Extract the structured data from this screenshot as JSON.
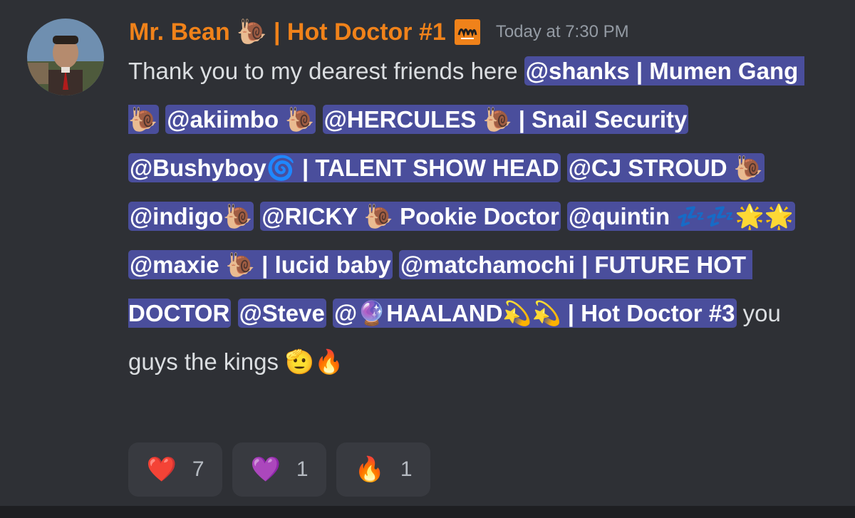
{
  "message": {
    "author": "Mr. Bean 🐌 | Hot Doctor #1",
    "timestamp": "Today at 7:30 PM",
    "content": [
      {
        "type": "text",
        "text": "Thank you to my dearest friends here "
      },
      {
        "type": "mention",
        "text": "@shanks | Mumen Gang 🐌"
      },
      {
        "type": "text",
        "text": " "
      },
      {
        "type": "mention",
        "text": "@akiimbo 🐌"
      },
      {
        "type": "text",
        "text": " "
      },
      {
        "type": "mention",
        "text": "@HERCULES 🐌 | Snail Security"
      },
      {
        "type": "text",
        "text": " "
      },
      {
        "type": "mention",
        "text": "@Bushyboy🌀 | TALENT SHOW HEAD"
      },
      {
        "type": "text",
        "text": " "
      },
      {
        "type": "mention",
        "text": "@CJ STROUD 🐌"
      },
      {
        "type": "text",
        "text": " "
      },
      {
        "type": "mention",
        "text": "@indigo🐌"
      },
      {
        "type": "text",
        "text": " "
      },
      {
        "type": "mention",
        "text": "@RICKY 🐌 Pookie Doctor"
      },
      {
        "type": "text",
        "text": " "
      },
      {
        "type": "mention",
        "text": "@quintin 💤💤🌟🌟"
      },
      {
        "type": "text",
        "text": " "
      },
      {
        "type": "mention",
        "text": "@maxie 🐌 | lucid baby"
      },
      {
        "type": "text",
        "text": " "
      },
      {
        "type": "mention",
        "text": "@matchamochi | FUTURE HOT DOCTOR"
      },
      {
        "type": "text",
        "text": " "
      },
      {
        "type": "mention",
        "text": "@Steve"
      },
      {
        "type": "text",
        "text": " "
      },
      {
        "type": "mention",
        "text": "@🔮HAALAND💫💫 | Hot Doctor #3"
      },
      {
        "type": "text",
        "text": " you guys the kings 🫡🔥"
      }
    ]
  },
  "reactions": [
    {
      "emoji": "❤️",
      "count": "7",
      "icon": "red-heart-icon"
    },
    {
      "emoji": "💜",
      "count": "1",
      "icon": "purple-heart-icon"
    },
    {
      "emoji": "🔥",
      "count": "1",
      "icon": "fire-icon"
    }
  ],
  "colors": {
    "background": "#2e3035",
    "username": "#f0821a",
    "mention_bg": "#4a4e9c",
    "timestamp": "#949ba4"
  }
}
